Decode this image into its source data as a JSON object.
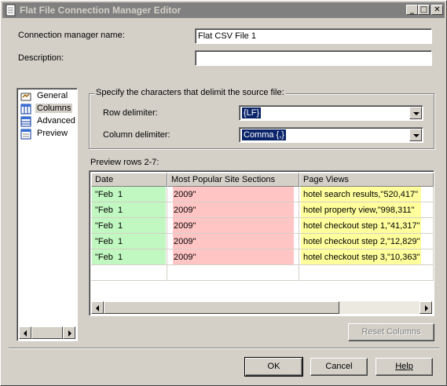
{
  "window": {
    "title": "Flat File Connection Manager Editor",
    "minimize": "_",
    "maximize": "□",
    "close": "✕"
  },
  "form": {
    "name_label": "Connection manager name:",
    "name_value": "Flat CSV File 1",
    "description_label": "Description:",
    "description_value": ""
  },
  "nav": {
    "items": [
      {
        "label": "General",
        "icon": "general-icon",
        "selected": false
      },
      {
        "label": "Columns",
        "icon": "columns-icon",
        "selected": true
      },
      {
        "label": "Advanced",
        "icon": "advanced-icon",
        "selected": false
      },
      {
        "label": "Preview",
        "icon": "preview-icon",
        "selected": false
      }
    ]
  },
  "delimiters": {
    "group_title": "Specify the characters that delimit the source file:",
    "row_label": "Row delimiter:",
    "row_value": "{LF}",
    "column_label": "Column delimiter:",
    "column_value": "Comma {,}"
  },
  "preview": {
    "title": "Preview rows 2-7:",
    "columns": [
      "Date",
      "Most Popular Site Sections",
      "Page Views"
    ],
    "rows": [
      [
        "\"Feb  1",
        "2009\"",
        "hotel search results,\"520,417\""
      ],
      [
        "\"Feb  1",
        "2009\"",
        "hotel property view,\"998,311\""
      ],
      [
        "\"Feb  1",
        "2009\"",
        "hotel checkout step 1,\"41,317\""
      ],
      [
        "\"Feb  1",
        "2009\"",
        "hotel checkout step 2,\"12,829\""
      ],
      [
        "\"Feb  1",
        "2009\"",
        "hotel checkout step 3,\"10,363\""
      ]
    ],
    "column_colors": [
      "#c1f7c1",
      "#ffc4c4",
      "#ffff9c"
    ]
  },
  "buttons": {
    "reset_columns": "Reset Columns",
    "ok": "OK",
    "cancel": "Cancel",
    "help": "Help"
  }
}
